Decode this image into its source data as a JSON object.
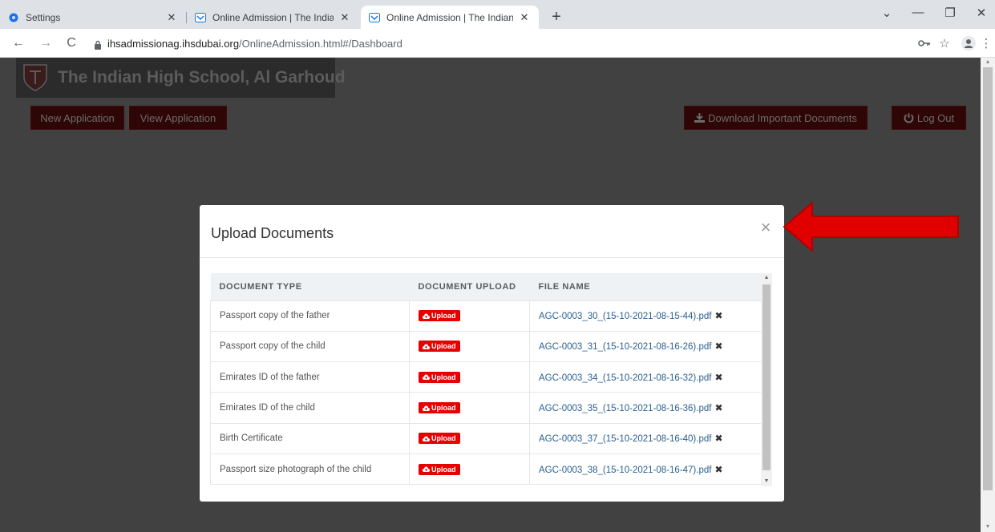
{
  "browser": {
    "tabs": [
      {
        "title": "Settings",
        "close": "✕"
      },
      {
        "title": "Online Admission | The Indian Hi",
        "close": "✕"
      },
      {
        "title": "Online Admission | The Indian Hi",
        "close": "✕"
      }
    ],
    "new_tab": "+",
    "window_controls": {
      "dropdown": "⌄",
      "minimize": "—",
      "restore": "❐",
      "close": "✕"
    },
    "url_domain": "ihsadmissionag.ihsdubai.org",
    "url_path": "/OnlineAdmission.html#/Dashboard",
    "nav": {
      "back": "←",
      "forward": "→",
      "reload": "C"
    },
    "icons": [
      "back-icon",
      "forward-icon",
      "reload-icon",
      "lock-icon",
      "key-icon",
      "star-icon",
      "profile-icon",
      "menu-icon"
    ]
  },
  "page": {
    "school_name": "The Indian High School, Al Garhoud",
    "buttons": {
      "new_application": "New Application",
      "view_application": "View Application",
      "download_documents": "Download Important Documents",
      "log_out": "Log Out"
    }
  },
  "modal": {
    "title": "Upload Documents",
    "close": "×",
    "columns": [
      "DOCUMENT TYPE",
      "DOCUMENT UPLOAD",
      "FILE NAME"
    ],
    "upload_label": "Upload",
    "remove_symbol": "✖",
    "rows": [
      {
        "type": "Passport copy of the father",
        "file": "AGC-0003_30_(15-10-2021-08-15-44).pdf"
      },
      {
        "type": "Passport copy of the child",
        "file": "AGC-0003_31_(15-10-2021-08-16-26).pdf"
      },
      {
        "type": "Emirates ID of the father",
        "file": "AGC-0003_34_(15-10-2021-08-16-32).pdf"
      },
      {
        "type": "Emirates ID of the child",
        "file": "AGC-0003_35_(15-10-2021-08-16-36).pdf"
      },
      {
        "type": "Birth Certificate",
        "file": "AGC-0003_37_(15-10-2021-08-16-40).pdf"
      },
      {
        "type": "Passport size photograph of the child",
        "file": "AGC-0003_38_(15-10-2021-08-16-47).pdf"
      }
    ]
  },
  "colors": {
    "upload_button": "#e60000",
    "file_link": "#2a5f8f",
    "annotation_arrow": "#e00000",
    "overlay": "#414141"
  }
}
